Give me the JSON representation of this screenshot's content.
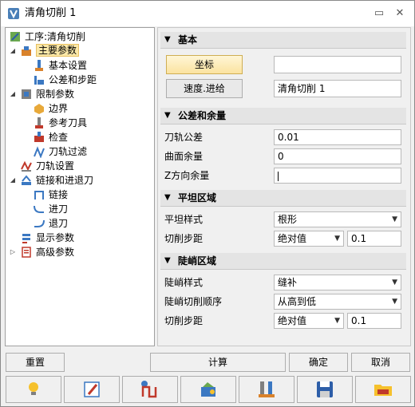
{
  "window": {
    "title": "清角切削 1"
  },
  "tree": {
    "root": "工序:清角切削",
    "items": [
      {
        "label": "主要参数"
      },
      {
        "label": "基本设置"
      },
      {
        "label": "公差和步距"
      },
      {
        "label": "限制参数"
      },
      {
        "label": "边界"
      },
      {
        "label": "参考刀具"
      },
      {
        "label": "检查"
      },
      {
        "label": "刀轨过滤"
      },
      {
        "label": "刀轨设置"
      },
      {
        "label": "链接和进退刀"
      },
      {
        "label": "链接"
      },
      {
        "label": "进刀"
      },
      {
        "label": "退刀"
      },
      {
        "label": "显示参数"
      },
      {
        "label": "高级参数"
      }
    ]
  },
  "basic": {
    "title": "基本",
    "coord_button": "坐标",
    "coord_value": "",
    "speed_button": "速度.进给",
    "speed_value": "清角切削 1"
  },
  "tolerance": {
    "title": "公差和余量",
    "toolpath_tol_label": "刀轨公差",
    "toolpath_tol_value": "0.01",
    "surface_allow_label": "曲面余量",
    "surface_allow_value": "0",
    "z_allow_label": "Z方向余量",
    "z_allow_value": ""
  },
  "flat": {
    "title": "平坦区域",
    "style_label": "平坦样式",
    "style_value": "根形",
    "step_label": "切削步距",
    "step_mode": "绝对值",
    "step_value": "0.1"
  },
  "steep": {
    "title": "陡峭区域",
    "style_label": "陡峭样式",
    "style_value": "缝补",
    "order_label": "陡峭切削顺序",
    "order_value": "从高到低",
    "step_label": "切削步距",
    "step_mode": "绝对值",
    "step_value": "0.1"
  },
  "actions": {
    "reset": "重置",
    "compute": "计算",
    "ok": "确定",
    "cancel": "取消"
  },
  "toolbar": [
    "bulb-icon",
    "edit-icon",
    "toolpath-icon",
    "simulate-icon",
    "tools-icon",
    "save-icon",
    "open-folder-icon"
  ]
}
